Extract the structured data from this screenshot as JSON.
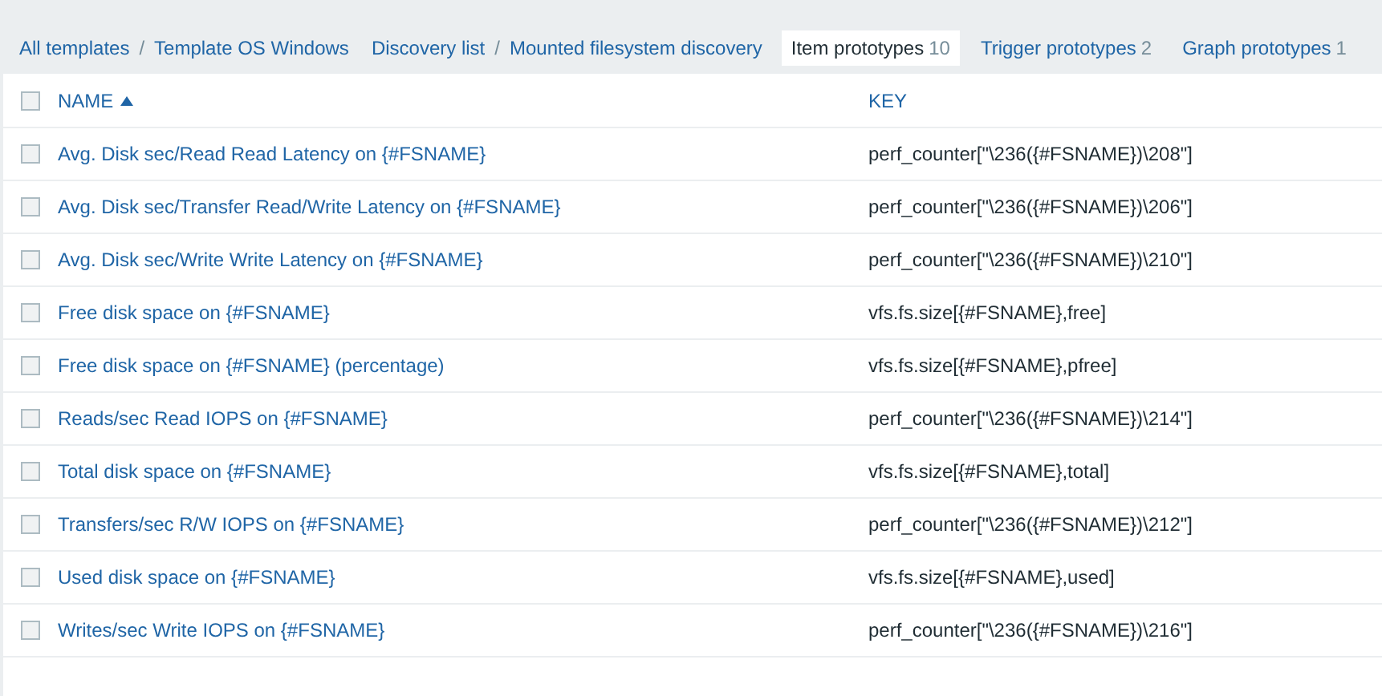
{
  "breadcrumbs": [
    {
      "kind": "link",
      "label": "All templates"
    },
    {
      "kind": "sep",
      "label": "/"
    },
    {
      "kind": "link",
      "label": "Template OS Windows"
    },
    {
      "kind": "gap"
    },
    {
      "kind": "link",
      "label": "Discovery list"
    },
    {
      "kind": "sep",
      "label": "/"
    },
    {
      "kind": "link",
      "label": "Mounted filesystem discovery"
    },
    {
      "kind": "tab",
      "label": "Item prototypes",
      "count": "10",
      "selected": true
    },
    {
      "kind": "tab",
      "label": "Trigger prototypes",
      "count": "2",
      "selected": false
    },
    {
      "kind": "tab",
      "label": "Graph prototypes",
      "count": "1",
      "selected": false
    }
  ],
  "table": {
    "select_all_checked": false,
    "columns": [
      {
        "label": "NAME",
        "sorted_ascending": true
      },
      {
        "label": "KEY",
        "sorted_ascending": false
      }
    ],
    "rows": [
      {
        "name": "Avg. Disk sec/Read Read Latency on {#FSNAME}",
        "key": "perf_counter[\"\\236({#FSNAME})\\208\"]",
        "checked": false
      },
      {
        "name": "Avg. Disk sec/Transfer Read/Write Latency on {#FSNAME}",
        "key": "perf_counter[\"\\236({#FSNAME})\\206\"]",
        "checked": false
      },
      {
        "name": "Avg. Disk sec/Write Write Latency on {#FSNAME}",
        "key": "perf_counter[\"\\236({#FSNAME})\\210\"]",
        "checked": false
      },
      {
        "name": "Free disk space on {#FSNAME}",
        "key": "vfs.fs.size[{#FSNAME},free]",
        "checked": false
      },
      {
        "name": "Free disk space on {#FSNAME} (percentage)",
        "key": "vfs.fs.size[{#FSNAME},pfree]",
        "checked": false
      },
      {
        "name": "Reads/sec Read IOPS on {#FSNAME}",
        "key": "perf_counter[\"\\236({#FSNAME})\\214\"]",
        "checked": false
      },
      {
        "name": "Total disk space on {#FSNAME}",
        "key": "vfs.fs.size[{#FSNAME},total]",
        "checked": false
      },
      {
        "name": "Transfers/sec R/W IOPS on {#FSNAME}",
        "key": "perf_counter[\"\\236({#FSNAME})\\212\"]",
        "checked": false
      },
      {
        "name": "Used disk space on {#FSNAME}",
        "key": "vfs.fs.size[{#FSNAME},used]",
        "checked": false
      },
      {
        "name": "Writes/sec Write IOPS on {#FSNAME}",
        "key": "perf_counter[\"\\236({#FSNAME})\\216\"]",
        "checked": false
      }
    ]
  }
}
